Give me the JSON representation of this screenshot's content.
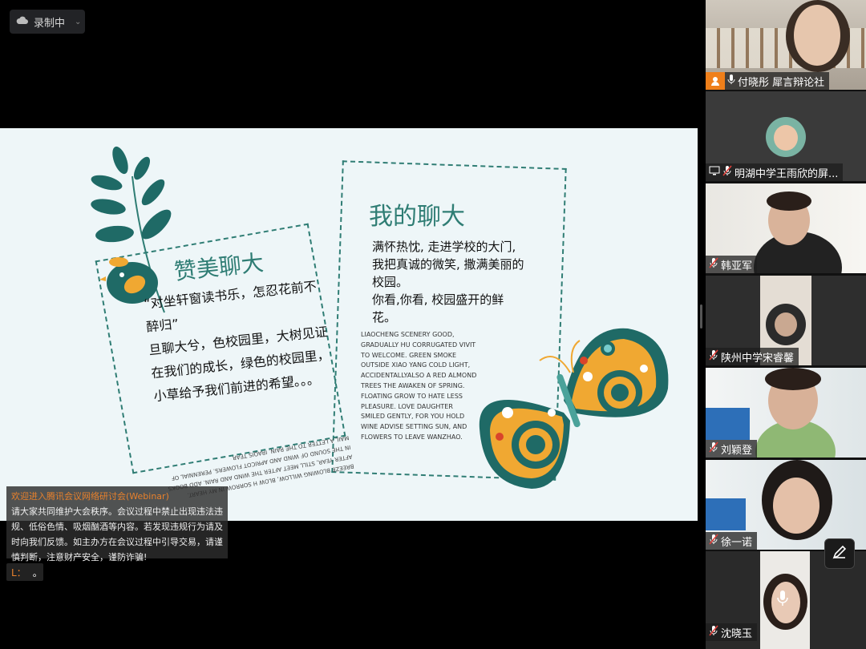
{
  "recording": {
    "label": "录制中"
  },
  "slide": {
    "title_left": "赞美聊大",
    "title_right": "我的聊大",
    "left_lines": [
      "“对坐轩窗读书乐，怎忍花前不醉归”",
      "旦聊大兮，色校园里，大树见证在我们的成长，绿色的校园里，小草给予我们前进的希望。。。"
    ],
    "right_lines": [
      "满怀热忱, 走进学校的大门,",
      "我把真诚的微笑, 撒满美丽的校园。",
      "你看,你看, 校园盛开的鲜花。"
    ],
    "english_right": "LIAOCHENG SCENERY GOOD, GRADUALLY HU CORRUGATED VIVIT TO WELCOME. GREEN SMOKE OUTSIDE XIAO YANG COLD LIGHT, ACCIDENTALLYALSO A RED ALMOND TREES THE AWAKEN OF SPRING. FLOATING GROW TO HATE LESS PLEASURE. LOVE DAUGHTER SMILED GENTLY, FOR YOU HOLD WINE ADVISE SETTING SUN, AND FLOWERS TO LEAVE WANZHAO.",
    "english_left": "BREEZE BLOWING WILLOW, BLOW H SORROW IN MY HEART. AFTER YEAR, STILL MEET AFTER THE WIND AND RAIN. ADD BOOKS IN THE SOUND OF WIND AND APRICOT FLOWERS. PERENNIAL OF MAIL A LETTER TO THE RAIN. IRAQIS TEAR"
  },
  "notice": {
    "title": "欢迎进入腾讯会议网络研讨会(Webinar)",
    "body": "请大家共同维护大会秩序。会议过程中禁止出现违法违规、低俗色情、吸烟酗酒等内容。若发现违规行为请及时向我们反馈。如主办方在会议过程中引导交易，请谨慎判断，注意财产安全，谨防诈骗!"
  },
  "chat": {
    "prefix": "L：",
    "text": "。"
  },
  "participants": [
    {
      "name": "付晓彤 犀言辩论社"
    },
    {
      "name": "明湖中学王雨欣的屏..."
    },
    {
      "name": "韩亚军"
    },
    {
      "name": "陕州中学宋睿馨"
    },
    {
      "name": "刘颖登"
    },
    {
      "name": "徐一诺"
    },
    {
      "name": "沈晓玉"
    }
  ],
  "colors": {
    "accent": "#2f7d74",
    "orange": "#e8812c",
    "background": "#000000"
  },
  "icons": [
    "cloud-icon",
    "mic-icon",
    "person-icon",
    "screen-share-icon",
    "pen-icon",
    "chevron-down-icon"
  ]
}
